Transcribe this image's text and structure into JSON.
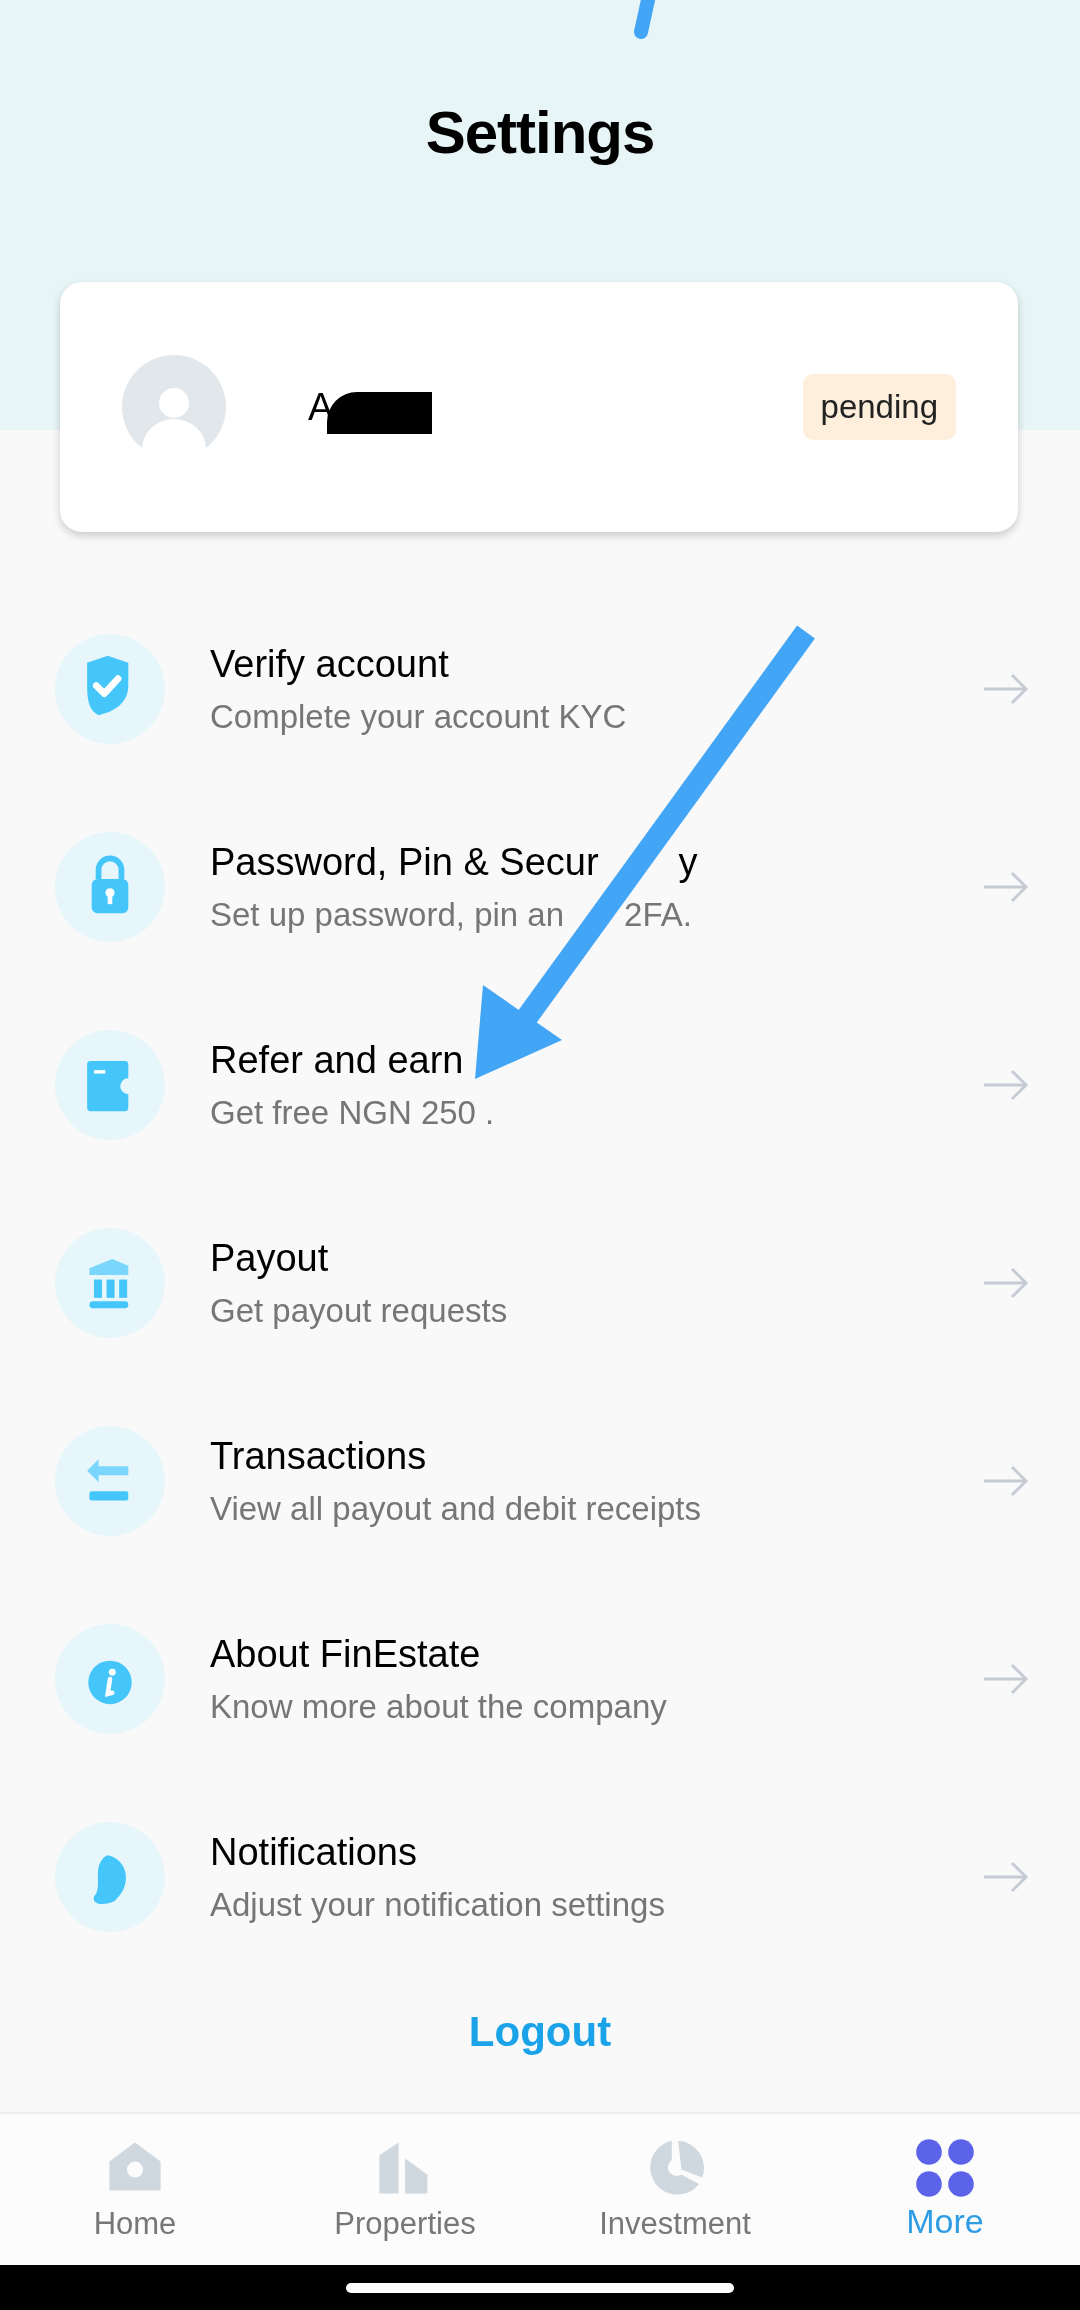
{
  "header": {
    "title": "Settings"
  },
  "profile": {
    "name": "A",
    "status": "pending"
  },
  "menu": [
    {
      "title": "Verify account",
      "subtitle": "Complete your account KYC"
    },
    {
      "title": "Password, Pin &  Secur",
      "title_after": "y",
      "subtitle": "Set up password, pin an",
      "subtitle_after": "2FA."
    },
    {
      "title": "Refer and earn",
      "subtitle": "Get free NGN 250 ."
    },
    {
      "title": "Payout",
      "subtitle": "Get payout requests"
    },
    {
      "title": "Transactions",
      "subtitle": "View all payout and debit receipts"
    },
    {
      "title": "About FinEstate",
      "subtitle": "Know more about the company"
    },
    {
      "title": "Notifications",
      "subtitle": "Adjust your notification settings"
    }
  ],
  "logout": "Logout",
  "tabs": [
    {
      "label": "Home",
      "selected": false
    },
    {
      "label": "Properties",
      "selected": false
    },
    {
      "label": "Investment",
      "selected": false
    },
    {
      "label": "More",
      "selected": true
    }
  ]
}
